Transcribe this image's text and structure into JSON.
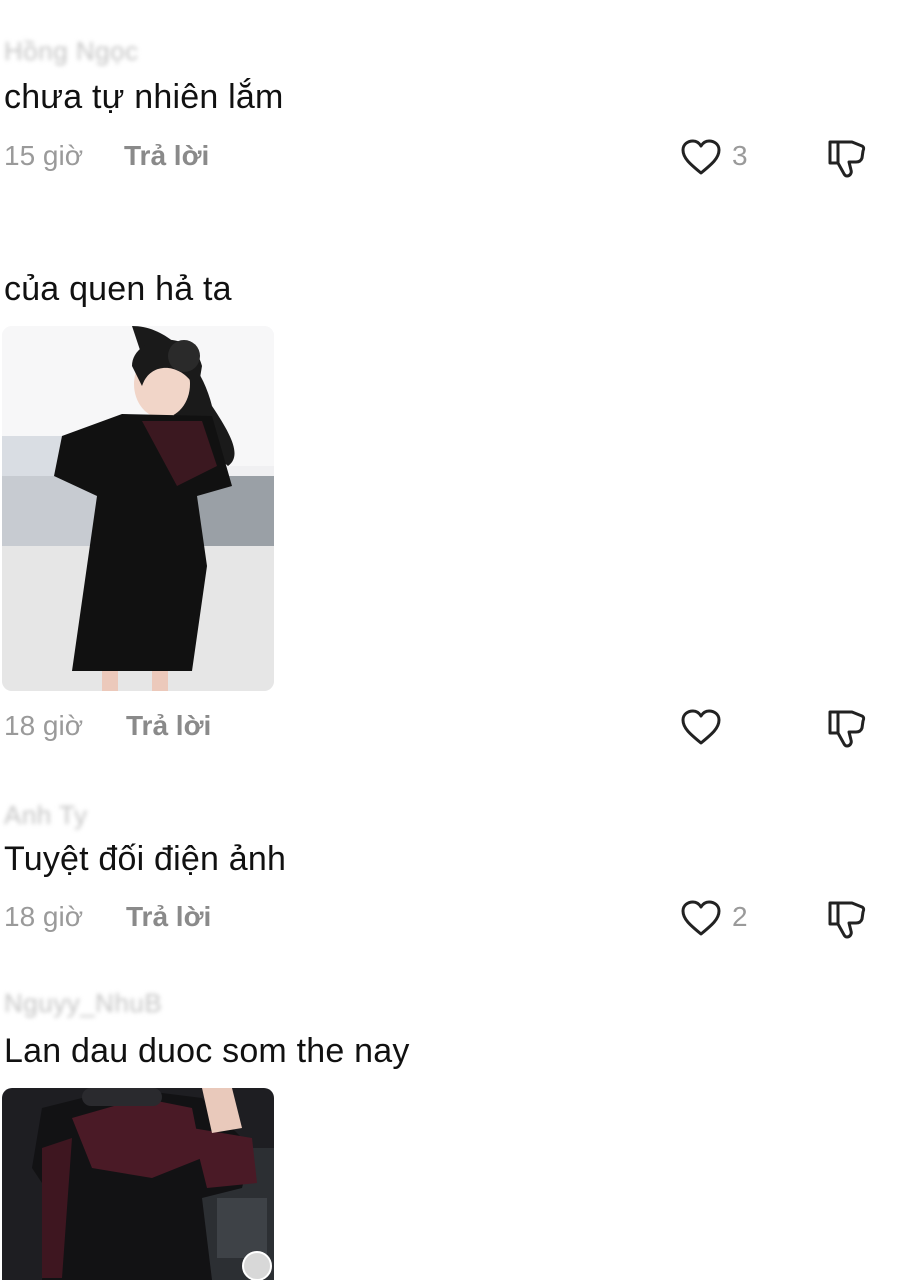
{
  "comments": [
    {
      "username": "Hồng Ngọc",
      "text": "chưa tự nhiên lắm",
      "time": "15 giờ",
      "reply_label": "Trả lời",
      "likes": "3"
    },
    {
      "username": "",
      "text": "của quen hả ta",
      "time": "18 giờ",
      "reply_label": "Trả lời",
      "likes": "",
      "has_image": true
    },
    {
      "username": "Anh Ty",
      "text": "Tuyệt đối điện ảnh",
      "time": "18 giờ",
      "reply_label": "Trả lời",
      "likes": "2"
    },
    {
      "username": "Nguyy_NhuB",
      "text": "Lan dau duoc som the nay",
      "has_image": true
    }
  ],
  "icons": {
    "like": "heart-outline-icon",
    "dislike": "thumbs-down-icon"
  },
  "colors": {
    "text": "#111111",
    "meta": "#9a9a9a",
    "icon": "#222222",
    "username_blur": "#c4c4c4"
  }
}
